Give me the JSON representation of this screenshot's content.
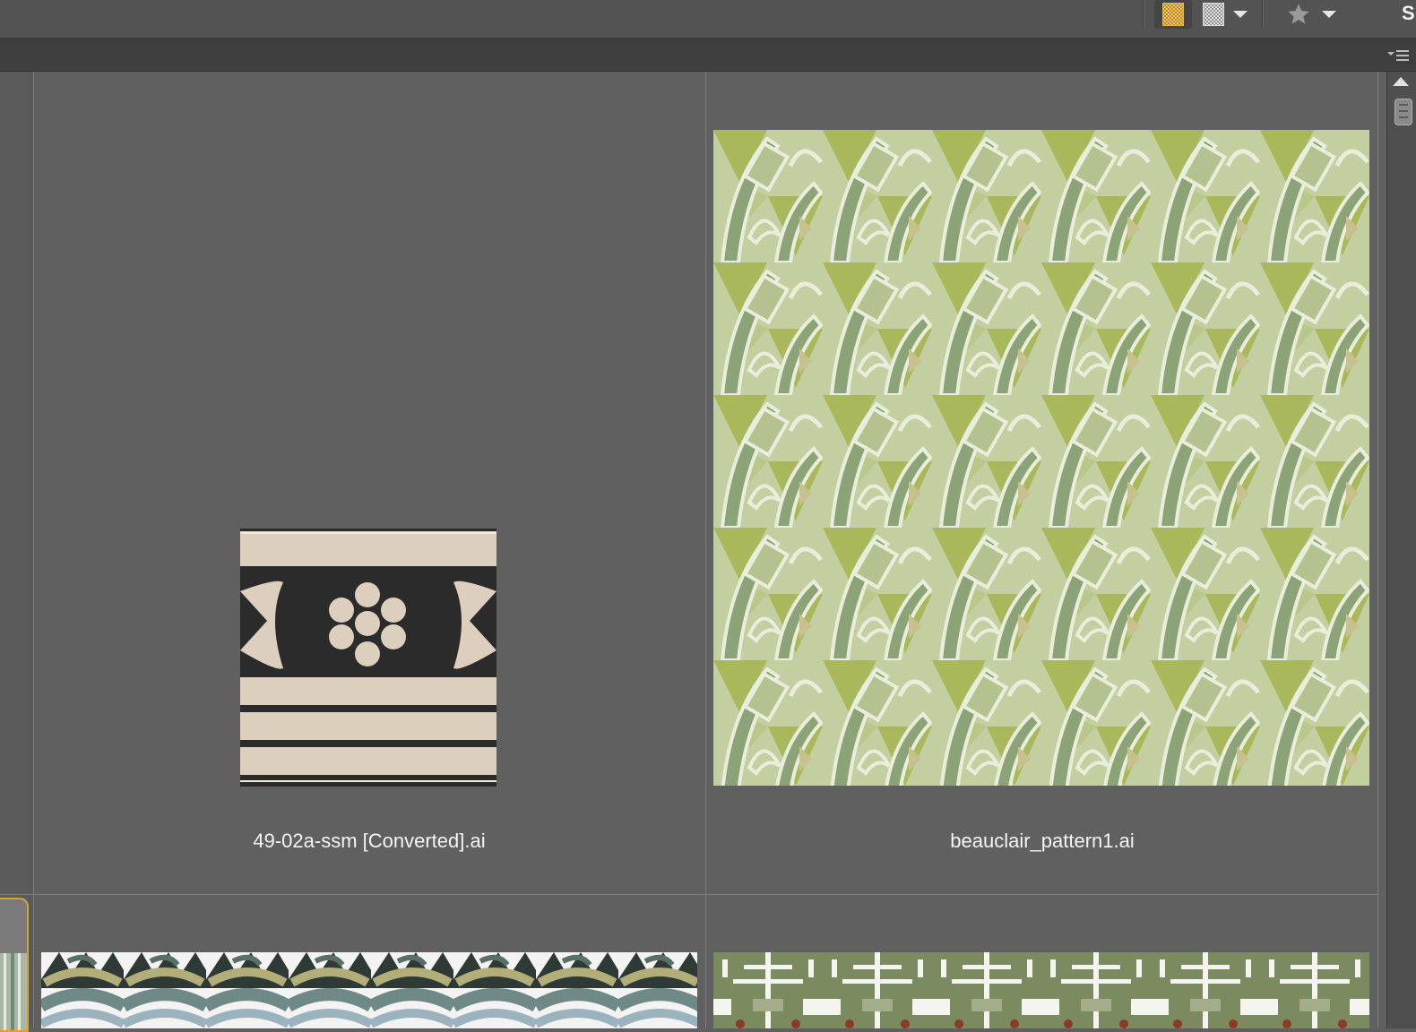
{
  "toolbar": {
    "edge_text": "S",
    "buttons": [
      {
        "name": "quality-thumbnail",
        "icon": "checkerboard-orange-icon",
        "active": true
      },
      {
        "name": "quality-preview",
        "icon": "checkerboard-gray-icon",
        "active": false
      },
      {
        "name": "rating-filter",
        "icon": "star-icon",
        "active": false
      }
    ]
  },
  "subbar": {
    "menu_icon": "panel-menu-icon"
  },
  "grid": {
    "items": [
      {
        "filename": "49-02a-ssm [Converted].ai",
        "thumbnail": "tile-pattern-thumbnail"
      },
      {
        "filename": "beauclair_pattern1.ai",
        "thumbnail": "green-pattern-thumbnail"
      },
      {
        "filename": "",
        "thumbnail": "teal-wave-pattern-thumbnail"
      },
      {
        "filename": "",
        "thumbnail": "olive-cross-pattern-thumbnail"
      }
    ]
  },
  "colors": {
    "selection_border": "#d6a23c",
    "cream": "#dccfbd",
    "dark": "#2b2b2b",
    "sage": "#a9b98b",
    "olive": "#7b8a5f"
  }
}
